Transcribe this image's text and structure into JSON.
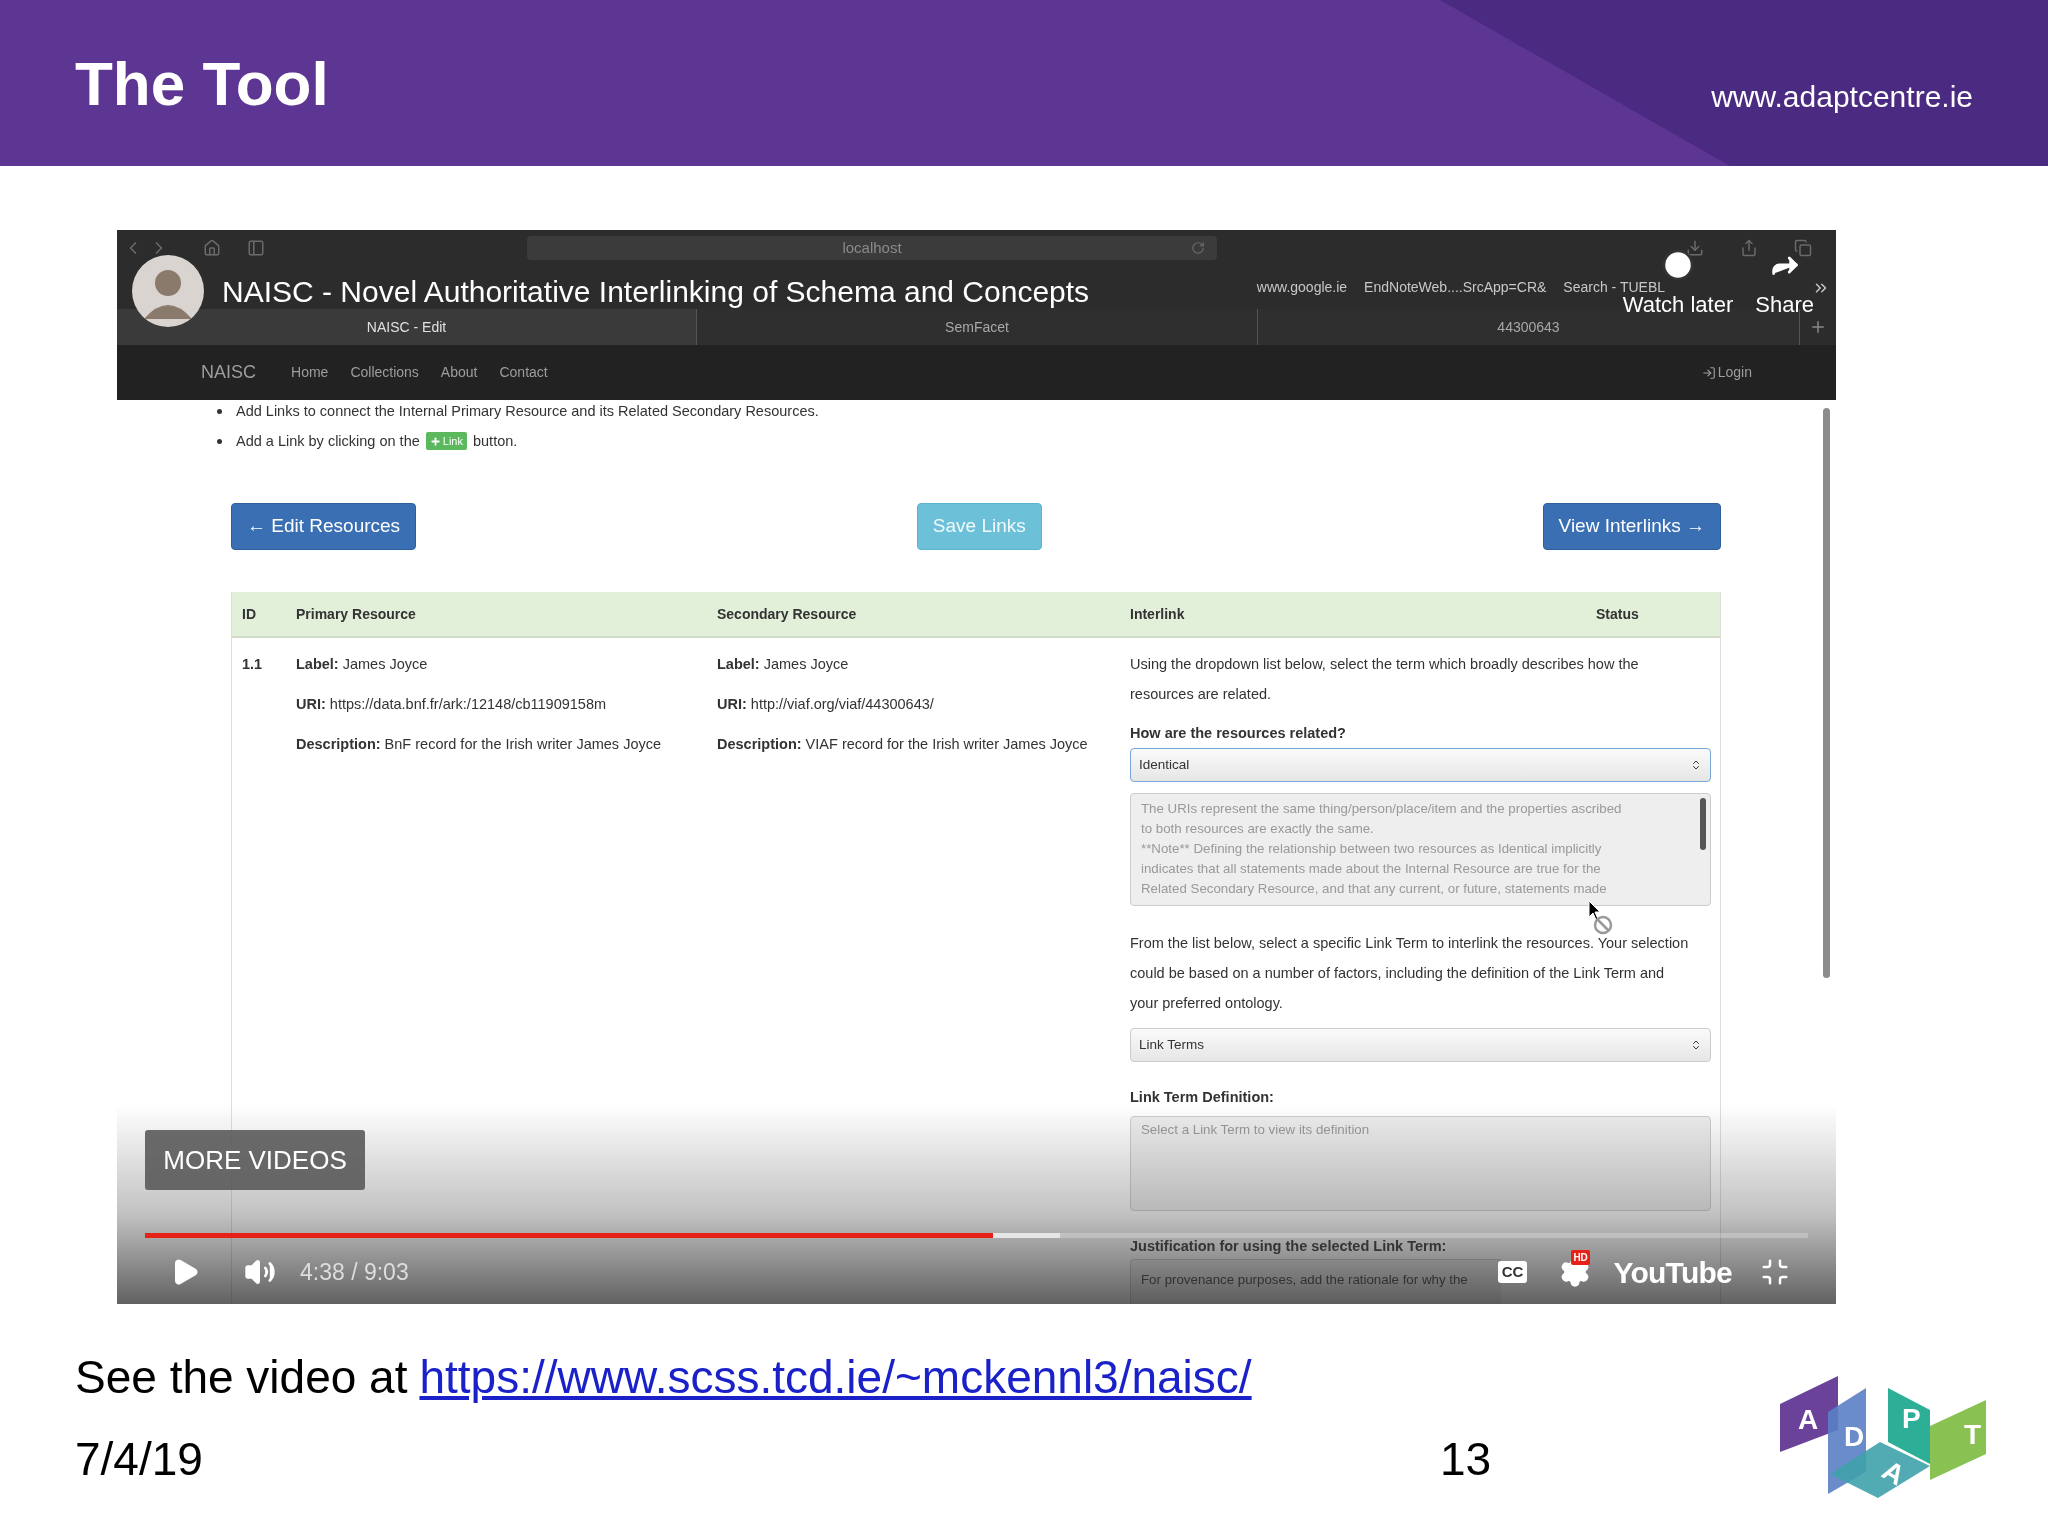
{
  "slide": {
    "title": "The Tool",
    "website": "www.adaptcentre.ie"
  },
  "video": {
    "browser": {
      "address": "localhost",
      "bookmarks": [
        "www.google.ie",
        "EndNoteWeb....SrcApp=CR&",
        "Search - TUEBL"
      ],
      "tabs": [
        {
          "label": "NAISC - Edit",
          "selected": true
        },
        {
          "label": "SemFacet",
          "selected": false
        },
        {
          "label": "44300643",
          "selected": false
        }
      ]
    },
    "overlay": {
      "title": "NAISC - Novel Authoritative Interlinking of Schema and Concepts",
      "watch_later": "Watch later",
      "share": "Share"
    },
    "app": {
      "brand": "NAISC",
      "nav": [
        "Home",
        "Collections",
        "About",
        "Contact"
      ],
      "login": "Login",
      "instructions": [
        {
          "kind": "text",
          "text": "Add Links to connect the Internal Primary Resource and its Related Secondary Resources."
        },
        {
          "kind": "badge",
          "before": "Add a Link by clicking on the",
          "badge": "Link",
          "after": "button."
        }
      ],
      "buttons": [
        {
          "label": "← Edit Resources",
          "kind": "primary"
        },
        {
          "label": "Save Links",
          "kind": "info"
        },
        {
          "label": "View Interlinks →",
          "kind": "primary"
        }
      ],
      "table": {
        "columns": [
          "ID",
          "Primary Resource",
          "Secondary Resource",
          "Interlink",
          "Status"
        ],
        "rows": [
          {
            "id": "1.1",
            "primary": [
              "**Label:** James Joyce",
              "**URI:** https://data.bnf.fr/ark:/12148/cb11909158m",
              "**Description:** BnF record for the Irish writer James Joyce"
            ],
            "secondary": [
              "**Label:** James Joyce",
              "**URI:** http://viaf.org/viaf/44300643/",
              "**Description:** VIAF record for the Irish writer James Joyce"
            ],
            "interlink": {
              "intro": [
                "Using the dropdown list below, select the term which broadly describes how the",
                "resources are related."
              ],
              "relation_label": "How are the resources related?",
              "relation_value": "Identical",
              "relation_definition": [
                "The URIs represent the same thing/person/place/item and the properties ascribed",
                "to both resources are exactly the same.",
                "**Note** Defining the relationship between two resources as Identical implicitly",
                "indicates that all statements made about the Internal Resource are true for the",
                "Related Secondary Resource, and that any current, or future, statements made"
              ],
              "term_intro": [
                "From the list below, select a specific Link Term to interlink the resources. Your selection",
                "could be based on a number of factors, including the definition of the Link Term and",
                "your preferred ontology."
              ],
              "term_value": "Link Terms",
              "definition_label": "Link Term Definition:",
              "definition_placeholder": "Select a Link Term to view its definition",
              "justification_label": "Justification for using the selected Link Term:",
              "justification_placeholder": "For provenance purposes, add the rationale for why the"
            }
          }
        ]
      }
    },
    "player": {
      "more_videos": "MORE VIDEOS",
      "progress": {
        "level": 0.51
      },
      "buffered": {
        "level": 0.55
      },
      "time": "4:38 / 9:03",
      "captions": "CC",
      "quality": "HD",
      "logo": "YouTube"
    }
  },
  "caption": {
    "text": "See the video at",
    "link": "https://www.scss.tcd.ie/~mckennl3/naisc/"
  },
  "footer": {
    "date": "7/4/19",
    "page_number": "13"
  },
  "logo": {
    "letters": [
      "A",
      "D",
      "P",
      "A",
      "T"
    ]
  }
}
